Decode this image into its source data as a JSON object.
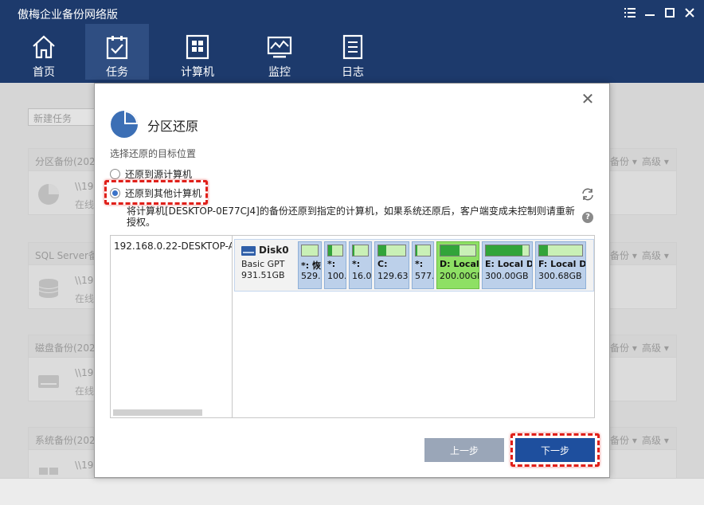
{
  "app": {
    "title": "傲梅企业备份网络版"
  },
  "window_controls": [
    "menu-icon",
    "minimize-icon",
    "maximize-icon",
    "close-icon"
  ],
  "nav": [
    {
      "label": "首页",
      "icon": "home-icon"
    },
    {
      "label": "任务",
      "icon": "task-icon",
      "active": true
    },
    {
      "label": "计算机",
      "icon": "computer-icon"
    },
    {
      "label": "监控",
      "icon": "monitor-icon"
    },
    {
      "label": "日志",
      "icon": "log-icon"
    }
  ],
  "background": {
    "new_task": "新建任务",
    "cards": [
      {
        "title": "分区备份(202",
        "path": "\\\\192",
        "status": "在线",
        "actions": [
          "备份",
          "高级"
        ]
      },
      {
        "title": "SQL Server备",
        "path": "\\\\192",
        "status": "在线",
        "actions": [
          "备份",
          "高级"
        ]
      },
      {
        "title": "磁盘备份(202",
        "path": "\\\\192",
        "status": "在线",
        "actions": [
          "备份",
          "高级"
        ]
      },
      {
        "title": "系统备份(202",
        "path": "\\\\192",
        "status": "在线",
        "actions": [
          "备份",
          "高级"
        ]
      }
    ]
  },
  "dialog": {
    "title": "分区还原",
    "subtitle": "选择还原的目标位置",
    "options": [
      {
        "label": "还原到源计算机",
        "checked": false
      },
      {
        "label": "还原到其他计算机",
        "checked": true
      }
    ],
    "info": "将计算机[DESKTOP-0E77CJ4]的备份还原到指定的计算机，如果系统还原后，客户端变成未控制则请重新授权。",
    "computer": "192.168.0.22-DESKTOP-AC",
    "disk": {
      "name": "Disk0",
      "type": "Basic GPT",
      "size": "931.51GB",
      "partitions": [
        {
          "label": "*: 恢",
          "size": "529.",
          "used": 0.0
        },
        {
          "label": "*:",
          "size": "100.",
          "used": 0.3
        },
        {
          "label": "*:",
          "size": "16.0",
          "used": 0.1
        },
        {
          "label": "C:",
          "size": "129.63",
          "used": 0.3
        },
        {
          "label": "*:",
          "size": "577.",
          "used": 0.1
        },
        {
          "label": "D: Local",
          "size": "200.00GB",
          "used": 0.55,
          "selected": true
        },
        {
          "label": "E: Local Di",
          "size": "300.00GB N",
          "used": 0.85
        },
        {
          "label": "F: Local Di",
          "size": "300.68GB N",
          "used": 0.2
        }
      ]
    },
    "buttons": {
      "prev": "上一步",
      "next": "下一步"
    }
  },
  "colors": {
    "header": "#1d3a6c",
    "accent": "#1e4f9e",
    "highlight": "#e0201a",
    "partition_selected": "#8ee064"
  }
}
